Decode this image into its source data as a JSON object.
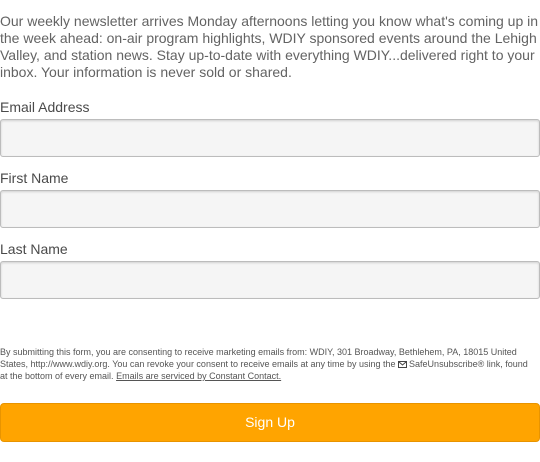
{
  "intro_text": "Our weekly newsletter arrives Monday afternoons letting you know what's coming up in the week ahead: on-air program highlights, WDIY sponsored events around the Lehigh Valley, and station news. Stay up-to-date with everything WDIY...delivered right to your inbox. Your information is never sold or shared.",
  "fields": [
    {
      "label": "Email Address",
      "value": "",
      "placeholder": ""
    },
    {
      "label": "First Name",
      "value": "",
      "placeholder": ""
    },
    {
      "label": "Last Name",
      "value": "",
      "placeholder": ""
    }
  ],
  "consent": {
    "text_before_icon": "By submitting this form, you are consenting to receive marketing emails from: WDIY, 301 Broadway, Bethlehem, PA, 18015 United States, http://www.wdiy.org. You can revoke your consent to receive emails at any time by using the ",
    "icon": "envelope-icon",
    "text_after_icon": "SafeUnsubscribe® link, found at the bottom of every email. ",
    "link_text": "Emails are serviced by Constant Contact."
  },
  "button": {
    "label": "Sign Up",
    "color": "#ffa400"
  }
}
